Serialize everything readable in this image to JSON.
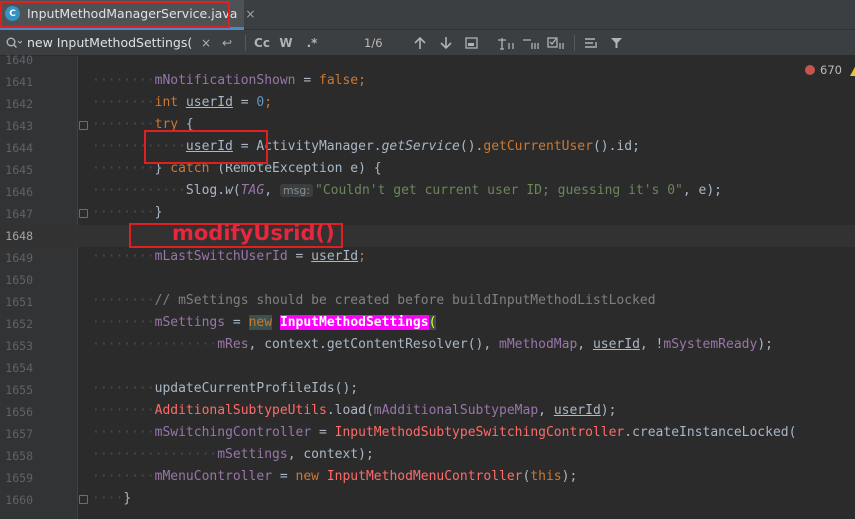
{
  "tab": {
    "icon_letter": "C",
    "title": "InputMethodManagerService.java",
    "close": "×"
  },
  "search": {
    "query": "new InputMethodSettings(",
    "match_count": "1/6",
    "case_label": "Cc",
    "words_label": "W",
    "regex_label": ".*",
    "clear": "×",
    "replace_icon": "↩"
  },
  "inspections": {
    "error_count": "670"
  },
  "annotation": "modifyUsrid()",
  "lines": {
    "n1640": "1640",
    "n1641": "1641",
    "n1642": "1642",
    "n1643": "1643",
    "n1644": "1644",
    "n1645": "1645",
    "n1646": "1646",
    "n1647": "1647",
    "n1648": "1648",
    "n1649": "1649",
    "n1650": "1650",
    "n1651": "1651",
    "n1652": "1652",
    "n1653": "1653",
    "n1654": "1654",
    "n1655": "1655",
    "n1656": "1656",
    "n1657": "1657",
    "n1658": "1658",
    "n1659": "1659",
    "n1660": "1660"
  },
  "code": {
    "l1641": {
      "a": "mNotificationShown",
      "b": " = ",
      "c": "false",
      "d": ";"
    },
    "l1642": {
      "a": "int ",
      "b": "userId",
      "c": " = ",
      "d": "0",
      "e": ";"
    },
    "l1643": {
      "a": "try",
      "b": " {"
    },
    "l1644": {
      "a": "userId",
      "b": " = ActivityManager.",
      "c": "getService",
      "d": "().",
      "e": "getCurrentUser",
      "f": "().id;"
    },
    "l1645": {
      "a": "} ",
      "b": "catch",
      "c": " (RemoteException e) {"
    },
    "l1646": {
      "a": "Slog.",
      "b": "w",
      "c": "(",
      "d": "TAG",
      "e": ", ",
      "hint": "msg:",
      "f": "\"Couldn't get current user ID; guessing it's 0\"",
      "g": ", e);"
    },
    "l1647": {
      "a": "}"
    },
    "l1649": {
      "a": "mLastSwitchUserId",
      "b": " = ",
      "c": "userId",
      "d": ";"
    },
    "l1651": {
      "a": "// mSettings should be created before buildInputMethodListLocked"
    },
    "l1652": {
      "a": "mSettings",
      "b": " = ",
      "c": "new",
      "d": " ",
      "e": "InputMethodSettings",
      "f": "("
    },
    "l1653": {
      "a": "mRes",
      "b": ", context.getContentResolver(), ",
      "c": "mMethodMap",
      "d": ", ",
      "e": "userId",
      "f": ", !",
      "g": "mSystemReady",
      "h": ");"
    },
    "l1655": {
      "a": "updateCurrentProfileIds();"
    },
    "l1656": {
      "a": "AdditionalSubtypeUtils",
      "b": ".load(",
      "c": "mAdditionalSubtypeMap",
      "d": ", ",
      "e": "userId",
      "f": ");"
    },
    "l1657": {
      "a": "mSwitchingController",
      "b": " = ",
      "c": "InputMethodSubtypeSwitchingController",
      "d": ".createInstanceLocked("
    },
    "l1658": {
      "a": "mSettings",
      "b": ", context);"
    },
    "l1659": {
      "a": "mMenuController",
      "b": " = ",
      "c": "new",
      "d": " ",
      "e": "InputMethodMenuController",
      "f": "(",
      "g": "this",
      "h": ");"
    },
    "l1660": {
      "a": "}"
    }
  }
}
